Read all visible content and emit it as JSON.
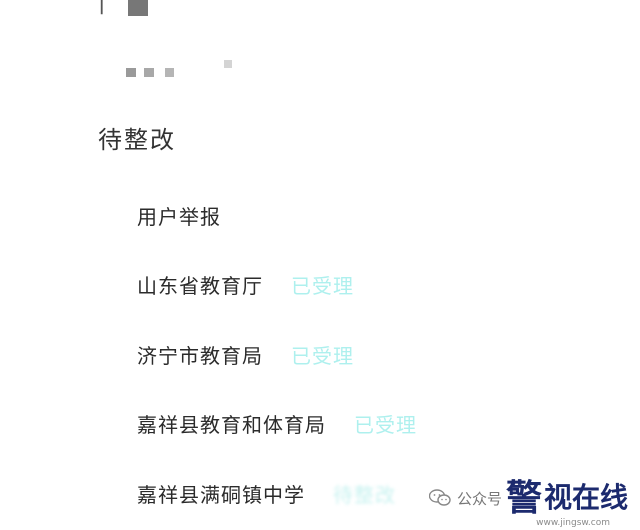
{
  "section": {
    "title": "待整改"
  },
  "flow": [
    {
      "label": "用户举报",
      "status": ""
    },
    {
      "label": "山东省教育厅",
      "status": "已受理"
    },
    {
      "label": "济宁市教育局",
      "status": "已受理"
    },
    {
      "label": "嘉祥县教育和体育局",
      "status": "已受理"
    },
    {
      "label": "嘉祥县满硐镇中学",
      "status": "待整改"
    }
  ],
  "watermark": {
    "prefix": "公众号",
    "logo_glyph": "警",
    "brand": "视在线",
    "url": "www.jingsw.com"
  },
  "colors": {
    "status_accepted": "#aef0ee",
    "brand": "#1c2a6e"
  },
  "icons": [
    "wechat-icon"
  ]
}
